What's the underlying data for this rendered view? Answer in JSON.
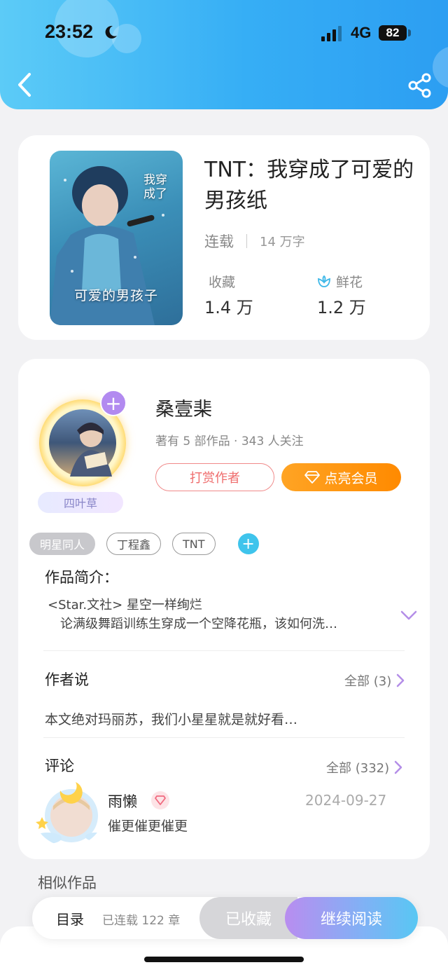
{
  "status_bar": {
    "time": "23:52",
    "network": "4G",
    "battery": "82"
  },
  "book": {
    "title": "TNT：我穿成了可爱的男孩纸",
    "status": "连载",
    "word_count": "14 万字",
    "collect_label": "收藏",
    "collect_value": "1.4 万",
    "flower_label": "鲜花",
    "flower_value": "1.2 万",
    "cover_title": "可爱的男孩子",
    "cover_vertical_title": "我穿成了"
  },
  "author": {
    "name": "桑壹棐",
    "meta": "著有 5 部作品 · 343 人关注",
    "badge": "四叶草",
    "tip_button": "打赏作者",
    "vip_button": "点亮会员"
  },
  "tags": [
    "明星同人",
    "丁程鑫",
    "TNT"
  ],
  "intro": {
    "title": "作品简介：",
    "line1": "<Star.文社> 星空一样绚烂",
    "line2": "论满级舞蹈训练生穿成一个空降花瓶，该如何洗…"
  },
  "author_say": {
    "title": "作者说",
    "all_link": "全部 (3)",
    "text": "本文绝对玛丽苏，我们小星星就是就好看…"
  },
  "comments": {
    "title": "评论",
    "all_link": "全部 (332)",
    "user": "雨懒",
    "date": "2024-09-27",
    "text": "催更催更催更"
  },
  "similar_title": "相似作品",
  "action_bar": {
    "toc": "目录",
    "chapters": "已连载 122 章",
    "collected": "已收藏",
    "continue": "继续阅读"
  },
  "colors": {
    "header_accent": "#36aef5",
    "vip_orange": "#ff8a00",
    "tip_red": "#ef6d6d"
  }
}
